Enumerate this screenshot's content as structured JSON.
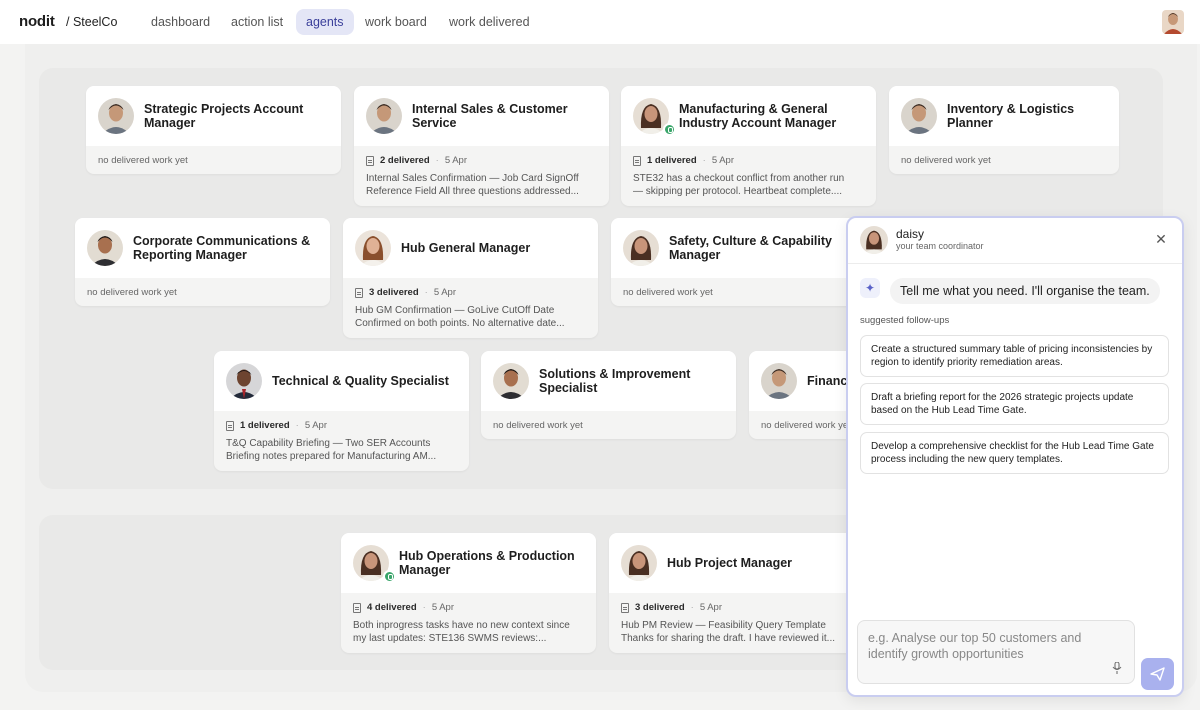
{
  "nav": {
    "brand": "nodit",
    "org": "/ SteelCo",
    "tabs": [
      "dashboard",
      "action list",
      "agents",
      "work board",
      "work delivered"
    ],
    "active_tab": "agents"
  },
  "cards": [
    {
      "name": "Strategic Projects Account Manager",
      "empty": "no delivered work yet"
    },
    {
      "name": "Internal Sales & Customer Service",
      "delivered": "2 delivered",
      "date": "5 Apr",
      "line1": "Internal Sales Confirmation — Job Card SignOff",
      "line2": "Reference Field All three questions addressed..."
    },
    {
      "name": "Manufacturing & General Industry Account Manager",
      "delivered": "1 delivered",
      "date": "5 Apr",
      "line1": "STE32 has a checkout conflict from another run",
      "line2": "— skipping per protocol. Heartbeat complete...."
    },
    {
      "name": "Inventory & Logistics Planner",
      "empty": "no delivered work yet"
    },
    {
      "name": "Corporate Communications & Reporting Manager",
      "empty": "no delivered work yet"
    },
    {
      "name": "Hub General Manager",
      "delivered": "3 delivered",
      "date": "5 Apr",
      "line1": "Hub GM Confirmation — GoLive CutOff Date",
      "line2": "Confirmed on both points. No alternative date..."
    },
    {
      "name": "Safety, Culture & Capability Manager",
      "empty": "no delivered work yet"
    },
    {
      "name": "Technical & Quality Specialist",
      "delivered": "1 delivered",
      "date": "5 Apr",
      "line1": "T&Q Capability Briefing — Two SER Accounts",
      "line2": "Briefing notes prepared for Manufacturing AM..."
    },
    {
      "name": "Solutions & Improvement Specialist",
      "empty": "no delivered work yet"
    },
    {
      "name": "Finance",
      "empty": "no delivered work yet"
    },
    {
      "name": "Hub Operations & Production Manager",
      "delivered": "4 delivered",
      "date": "5 Apr",
      "line1": "Both inprogress tasks have no new context since",
      "line2": "my last updates: STE136 SWMS reviews:..."
    },
    {
      "name": "Hub Project Manager",
      "delivered": "3 delivered",
      "date": "5 Apr",
      "line1": "Hub PM Review — Feasibility Query Template",
      "line2": "Thanks for sharing the draft. I have reviewed it..."
    }
  ],
  "chat": {
    "name": "daisy",
    "role": "your team coordinator",
    "greeting": "Tell me what you need. I'll organise the team.",
    "followups_label": "suggested follow-ups",
    "followups": [
      "Create a structured summary table of pricing inconsistencies by region to identify priority remediation areas.",
      "Draft a briefing report for the 2026 strategic projects update based on the Hub Lead Time Gate.",
      "Develop a comprehensive checklist for the Hub Lead Time Gate process including the new query templates."
    ],
    "placeholder": "e.g. Analyse our top 50 customers and identify growth opportunities"
  }
}
